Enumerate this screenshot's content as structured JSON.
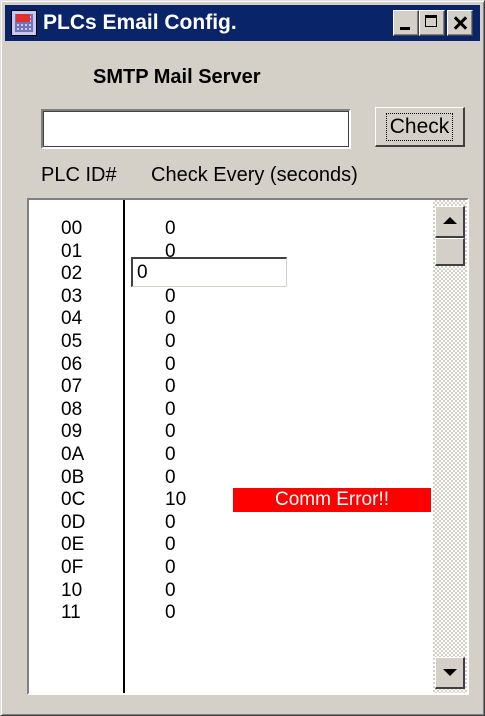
{
  "window": {
    "title": "PLCs Email Config."
  },
  "smtp": {
    "label": "SMTP Mail Server",
    "value": "",
    "check_label": "Check"
  },
  "columns": {
    "plc_id": "PLC ID#",
    "check_every": "Check Every (seconds)"
  },
  "rows": [
    {
      "id": "00",
      "every": "0",
      "status": ""
    },
    {
      "id": "01",
      "every": "0",
      "status": ""
    },
    {
      "id": "02",
      "every": "0",
      "status": ""
    },
    {
      "id": "03",
      "every": "0",
      "status": ""
    },
    {
      "id": "04",
      "every": "0",
      "status": ""
    },
    {
      "id": "05",
      "every": "0",
      "status": ""
    },
    {
      "id": "06",
      "every": "0",
      "status": ""
    },
    {
      "id": "07",
      "every": "0",
      "status": ""
    },
    {
      "id": "08",
      "every": "0",
      "status": ""
    },
    {
      "id": "09",
      "every": "0",
      "status": ""
    },
    {
      "id": "0A",
      "every": "0",
      "status": ""
    },
    {
      "id": "0B",
      "every": "0",
      "status": ""
    },
    {
      "id": "0C",
      "every": "10",
      "status": "Comm Error!!"
    },
    {
      "id": "0D",
      "every": "0",
      "status": ""
    },
    {
      "id": "0E",
      "every": "0",
      "status": ""
    },
    {
      "id": "0F",
      "every": "0",
      "status": ""
    },
    {
      "id": "10",
      "every": "0",
      "status": ""
    },
    {
      "id": "11",
      "every": "0",
      "status": ""
    }
  ],
  "editing_row": 2,
  "colors": {
    "titlebar": "#0a246a",
    "error_bg": "#ff0000",
    "error_text": "#ffffff"
  }
}
